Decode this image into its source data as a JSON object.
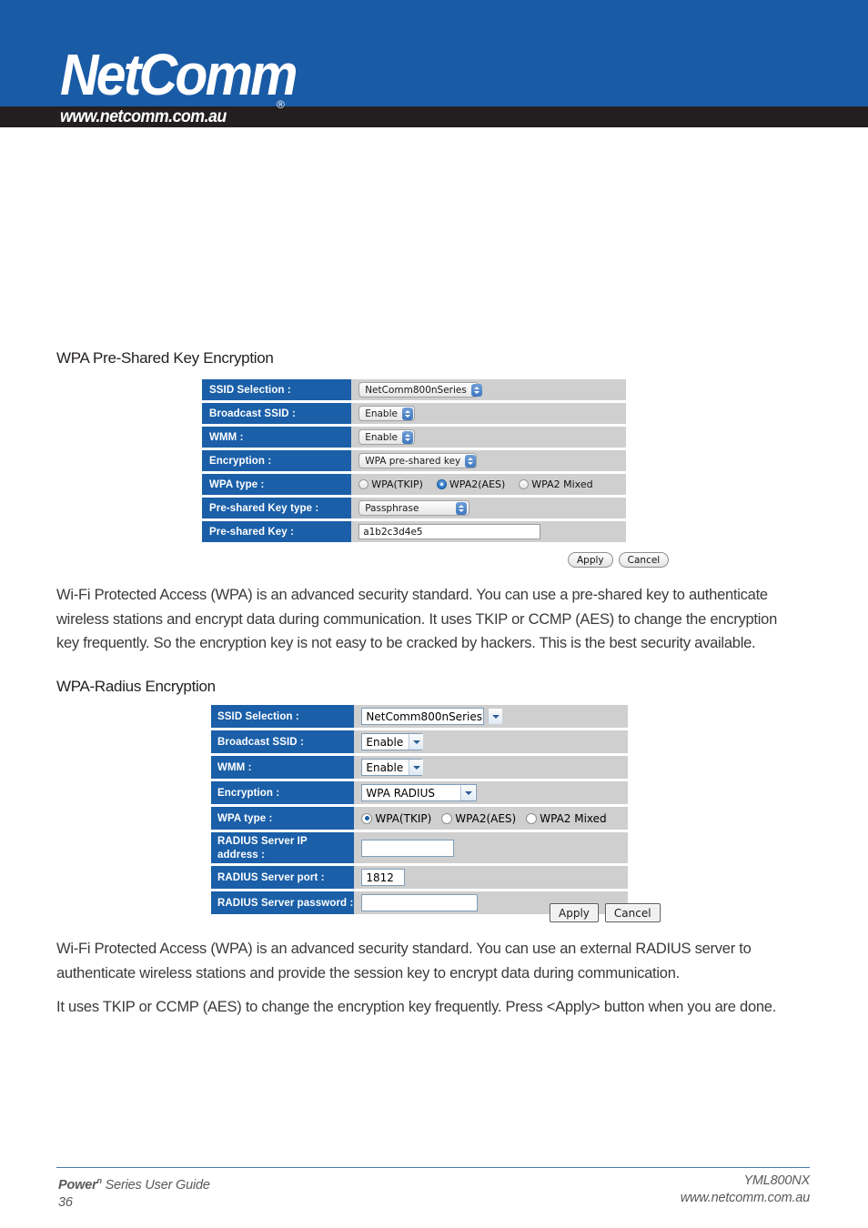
{
  "header": {
    "brand": "NetComm",
    "registered_mark": "®",
    "url": "www.netcomm.com.au",
    "band_color": "#1a5ba6",
    "bar_color": "#231f20"
  },
  "sections": [
    {
      "heading": "WPA Pre-Shared Key Encryption",
      "paragraphs": [
        "Wi-Fi Protected Access (WPA) is an advanced security standard. You can use a pre-shared key to authenticate wireless stations and encrypt data during communication. It uses TKIP or CCMP (AES) to change the encryption key frequently. So the encryption key is not easy to be cracked by hackers. This is the best security available."
      ]
    },
    {
      "heading": "WPA-Radius Encryption",
      "paragraphs": [
        "Wi-Fi Protected Access (WPA) is an advanced security standard. You can use an external RADIUS server to authenticate wireless stations and provide the session key to encrypt data during communication.",
        "It uses TKIP or CCMP (AES) to change the encryption key frequently. Press <Apply> button when you are done."
      ]
    }
  ],
  "form_psk": {
    "rows": {
      "ssid_selection_label": "SSID Selection :",
      "ssid_selection_value": "NetComm800nSeries",
      "broadcast_ssid_label": "Broadcast SSID :",
      "broadcast_ssid_value": "Enable",
      "wmm_label": "WMM :",
      "wmm_value": "Enable",
      "encryption_label": "Encryption :",
      "encryption_value": "WPA pre-shared key",
      "wpa_type_label": "WPA type :",
      "psk_type_label": "Pre-shared Key type :",
      "psk_type_value": "Passphrase",
      "psk_label": "Pre-shared Key :",
      "psk_value": "a1b2c3d4e5"
    },
    "wpa_type_options": [
      {
        "label": "WPA(TKIP)",
        "selected": false
      },
      {
        "label": "WPA2(AES)",
        "selected": true
      },
      {
        "label": "WPA2 Mixed",
        "selected": false
      }
    ],
    "buttons": {
      "apply": "Apply",
      "cancel": "Cancel"
    },
    "label_bg": "#1a5fa8",
    "value_bg": "#cfcfcf"
  },
  "form_radius": {
    "rows": {
      "ssid_selection_label": "SSID Selection :",
      "ssid_selection_value": "NetComm800nSeries",
      "broadcast_ssid_label": "Broadcast SSID :",
      "broadcast_ssid_value": "Enable",
      "wmm_label": "WMM :",
      "wmm_value": "Enable",
      "encryption_label": "Encryption :",
      "encryption_value": "WPA RADIUS",
      "wpa_type_label": "WPA type :",
      "radius_ip_label_line1": "RADIUS Server IP",
      "radius_ip_label_line2": "address :",
      "radius_ip_value": "",
      "radius_port_label": "RADIUS Server port :",
      "radius_port_value": "1812",
      "radius_password_label": "RADIUS Server password :",
      "radius_password_value": ""
    },
    "wpa_type_options": [
      {
        "label": "WPA(TKIP)",
        "selected": true
      },
      {
        "label": "WPA2(AES)",
        "selected": false
      },
      {
        "label": "WPA2 Mixed",
        "selected": false
      }
    ],
    "buttons": {
      "apply": "Apply",
      "cancel": "Cancel"
    },
    "label_bg": "#1a5fa8",
    "value_bg": "#cfcfcf"
  },
  "footer": {
    "guide_prefix": "Power",
    "guide_sup": "n",
    "guide_suffix": " Series User Guide",
    "page_number": "36",
    "model": "YML800NX",
    "url": "www.netcomm.com.au"
  }
}
